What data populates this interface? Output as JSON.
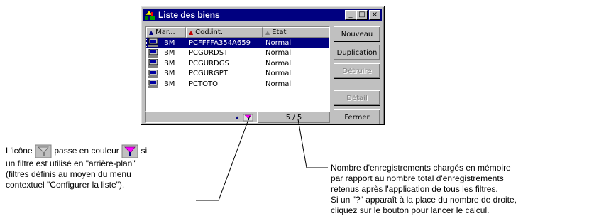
{
  "window": {
    "title": "Liste des biens",
    "buttons": [
      "_",
      "□",
      "×"
    ]
  },
  "list": {
    "columns": [
      {
        "label": "Mar..."
      },
      {
        "label": "Cod.int."
      },
      {
        "label": "Etat"
      }
    ],
    "rows": [
      {
        "brand": "IBM",
        "code": "PCFFFFA354A659",
        "state": "Normal",
        "selected": true
      },
      {
        "brand": "IBM",
        "code": "PCGURDST",
        "state": "Normal",
        "selected": false
      },
      {
        "brand": "IBM",
        "code": "PCGURDGS",
        "state": "Normal",
        "selected": false
      },
      {
        "brand": "IBM",
        "code": "PCGURGPT",
        "state": "Normal",
        "selected": false
      },
      {
        "brand": "IBM",
        "code": "PCTOTO",
        "state": "Normal",
        "selected": false
      }
    ]
  },
  "status": {
    "count": "5 / 5"
  },
  "buttons": {
    "nouveau": "Nouveau",
    "duplication": "Duplication",
    "detruire": "Détruire",
    "detail": "Détail",
    "fermer": "Fermer"
  },
  "notes": {
    "left": {
      "part1": "L'icône",
      "part2": "passe en couleur",
      "part3": "si",
      "line2": "un filtre est utilisé en \"arrière-plan\"",
      "line3": "(filtres définis au moyen du menu",
      "line4": "contextuel \"Configurer la liste\")."
    },
    "right": {
      "line1": "Nombre d'enregistrements chargés en mémoire",
      "line2": "par rapport au nombre total d'enregistrements",
      "line3": "retenus après l'application de tous les filtres.",
      "line4": "Si un \"?\" apparaît à la place du nombre de droite,",
      "line5": "cliquez sur le bouton pour lancer le calcul."
    }
  }
}
